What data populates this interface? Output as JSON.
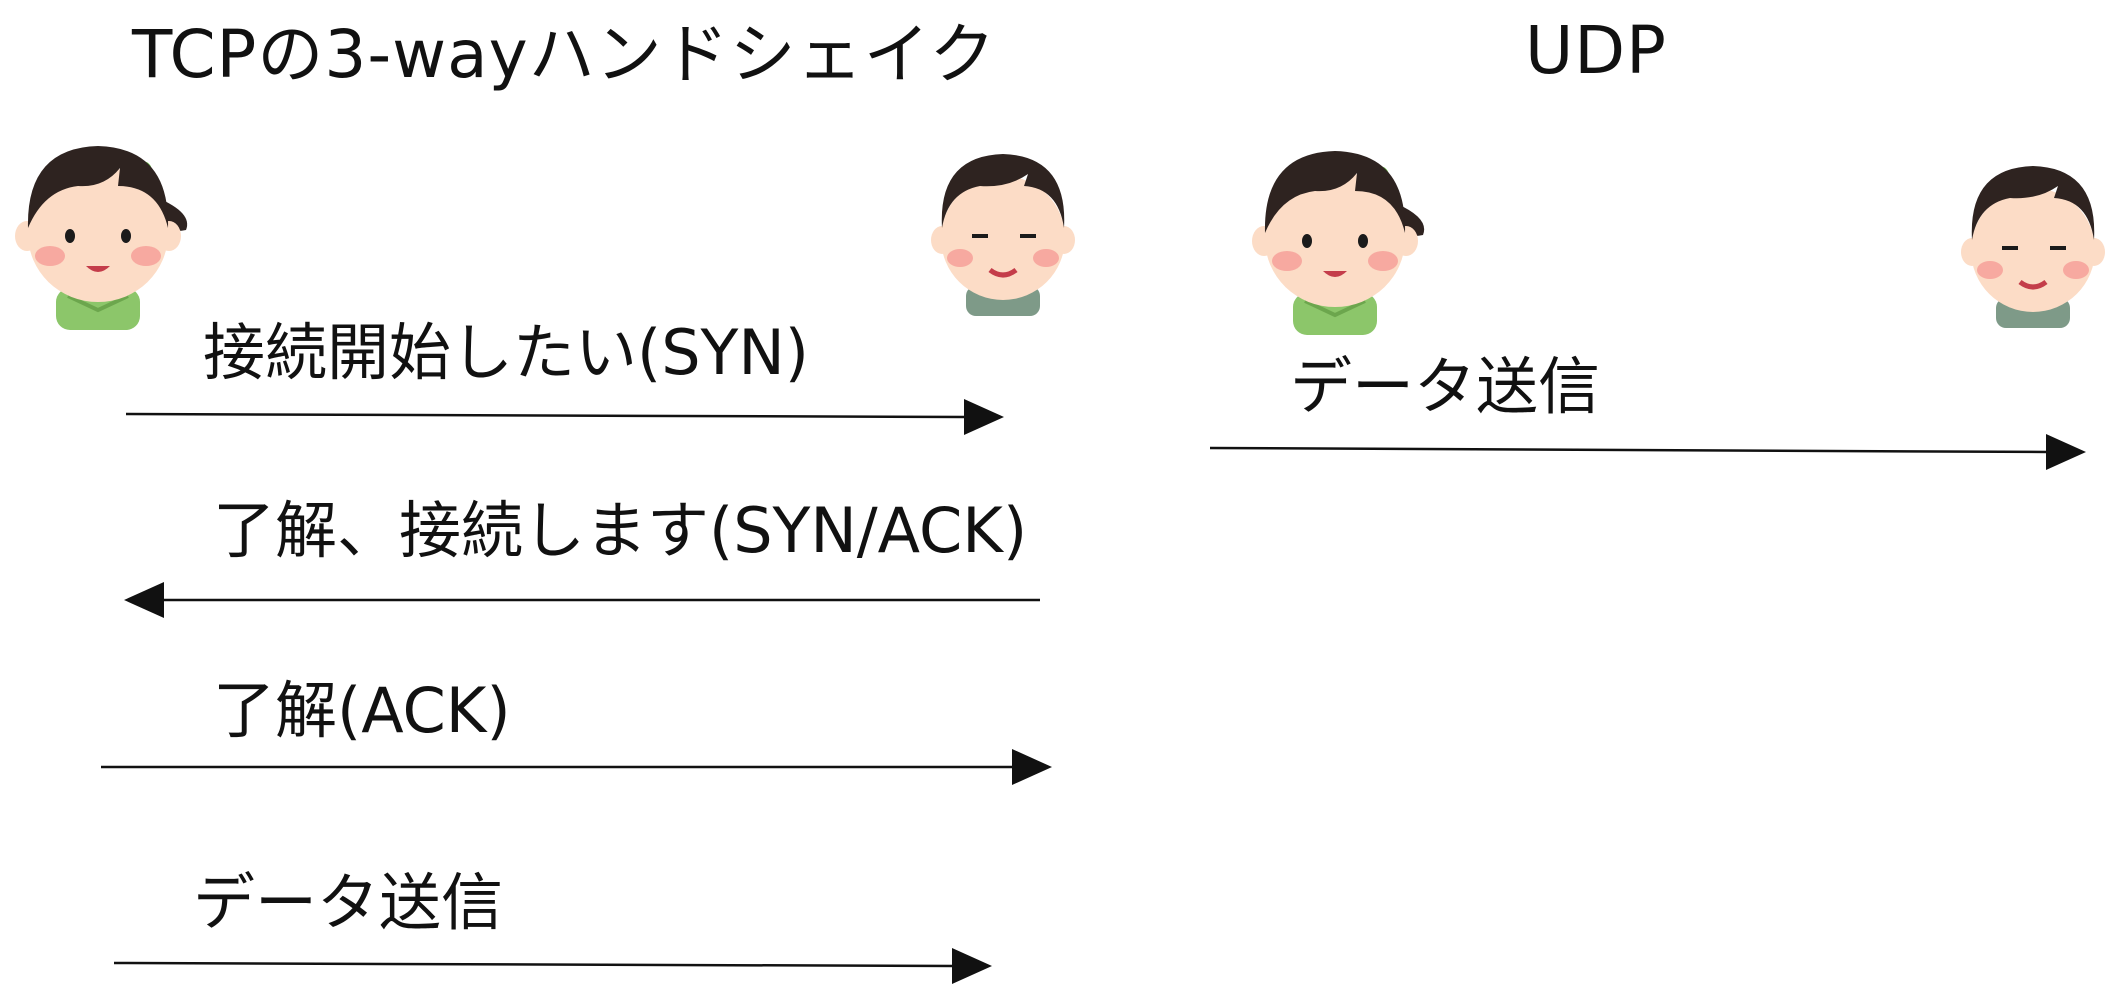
{
  "tcp": {
    "title": "TCPの3-wayハンドシェイク",
    "messages": [
      {
        "label": "接続開始したい(SYN)",
        "direction": "right"
      },
      {
        "label": "了解、接続します(SYN/ACK)",
        "direction": "left"
      },
      {
        "label": "了解(ACK)",
        "direction": "right"
      },
      {
        "label": "データ送信",
        "direction": "right"
      }
    ]
  },
  "udp": {
    "title": "UDP",
    "messages": [
      {
        "label": "データ送信",
        "direction": "right"
      }
    ]
  },
  "participants": {
    "sender_icon": "girl-avatar-icon",
    "receiver_icon": "boy-avatar-icon"
  },
  "colors": {
    "line": "#111111",
    "skin": "#fcdcc6",
    "cheek": "#f7a9a0",
    "hair": "#2e2320",
    "girl_shirt": "#8cc66a",
    "boy_shirt": "#7e9a88",
    "ribbon": "#5fb33c"
  }
}
